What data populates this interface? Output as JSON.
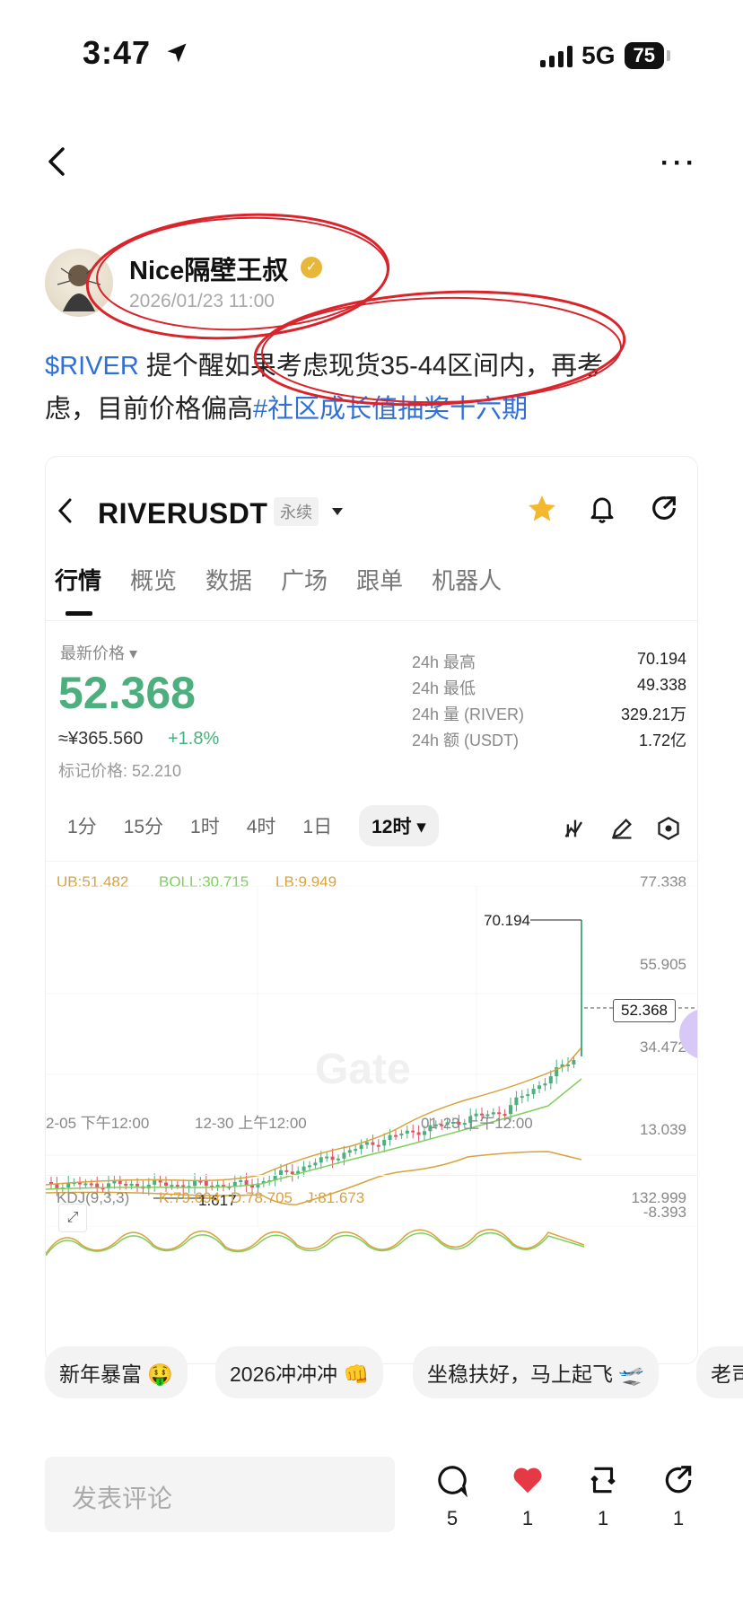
{
  "status_bar": {
    "time": "3:47",
    "network": "5G",
    "battery": "75"
  },
  "post": {
    "author": "Nice隔壁王叔",
    "date": "2026/01/23 11:00",
    "ticker": "$RIVER",
    "text_line1": " 提个醒如果考虑现货35-44区间内，再考",
    "text_line2": "虑，目前价格偏高",
    "hashtag": "#社区成长值抽奖十六期"
  },
  "card": {
    "pair": "RIVERUSDT",
    "perp_tag": "永续",
    "tabs": [
      "行情",
      "概览",
      "数据",
      "广场",
      "跟单",
      "机器人"
    ],
    "latest_label": "最新价格",
    "price": "52.368",
    "cny_price": "≈¥365.560",
    "change": "+1.8%",
    "mark_price": "标记价格: 52.210",
    "stats": [
      {
        "label": "24h  最高",
        "value": "70.194"
      },
      {
        "label": "24h  最低",
        "value": "49.338"
      },
      {
        "label": "24h  量 (RIVER)",
        "value": "329.21万"
      },
      {
        "label": "24h  额 (USDT)",
        "value": "1.72亿"
      }
    ],
    "intervals": [
      "1分",
      "15分",
      "1时",
      "4时",
      "1日",
      "12时"
    ],
    "indicators": {
      "ub": "UB:51.482",
      "boll": "BOLL:30.715",
      "lb": "LB:9.949"
    },
    "y_labels": [
      "77.338",
      "55.905",
      "34.472",
      "13.039",
      "-8.393"
    ],
    "high_marker": "70.194",
    "low_marker": "1.617",
    "current_tag": "52.368",
    "watermark": "Gate",
    "x_labels": [
      "2-05 下午12:00",
      "12-30 上午12:00",
      "01-23 上午12:00"
    ],
    "kdj": {
      "label": "KDJ(9,3,3)",
      "k": "K:79.694",
      "d": "D:78.705",
      "j": "J:81.673",
      "max": "132.999"
    }
  },
  "chips": [
    "新年暴富 🤑",
    "2026冲冲冲 👊",
    "坐稳扶好，马上起飞 🛫",
    "老司"
  ],
  "comment_placeholder": "发表评论",
  "actions": {
    "comments": "5",
    "likes": "1",
    "reposts": "1",
    "shares": "1"
  },
  "colors": {
    "up": "#4caf7d",
    "down": "#e05561",
    "link": "#2f6fd6",
    "ub": "#d9a23c",
    "boll": "#7fcf5e",
    "annotation": "#d9242c"
  }
}
